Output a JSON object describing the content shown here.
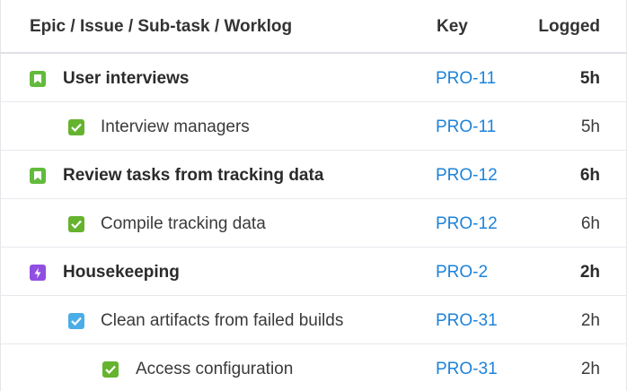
{
  "header": {
    "name_col": "Epic / Issue / Sub-task / Worklog",
    "key_col": "Key",
    "logged_col": "Logged"
  },
  "rows": [
    {
      "level": 0,
      "icon": "story-icon",
      "name": "User interviews",
      "key": "PRO-11",
      "logged": "5h"
    },
    {
      "level": 1,
      "icon": "subtask-checkbox-icon",
      "name": "Interview managers",
      "key": "PRO-11",
      "logged": "5h"
    },
    {
      "level": 0,
      "icon": "story-icon",
      "name": "Review tasks from tracking data",
      "key": "PRO-12",
      "logged": "6h"
    },
    {
      "level": 1,
      "icon": "subtask-checkbox-icon",
      "name": "Compile tracking data",
      "key": "PRO-12",
      "logged": "6h"
    },
    {
      "level": 0,
      "icon": "epic-icon",
      "name": "Housekeeping",
      "key": "PRO-2",
      "logged": "2h"
    },
    {
      "level": 1,
      "icon": "task-checkbox-icon",
      "name": "Clean artifacts from failed builds",
      "key": "PRO-31",
      "logged": "2h"
    },
    {
      "level": 2,
      "icon": "subtask-checkbox-icon",
      "name": "Access configuration",
      "key": "PRO-31",
      "logged": "2h"
    }
  ],
  "colors": {
    "story": "#63ba3c",
    "subtask": "#65b32e",
    "task": "#4bade8",
    "epic": "#904ee2",
    "link": "#1d83d9"
  }
}
